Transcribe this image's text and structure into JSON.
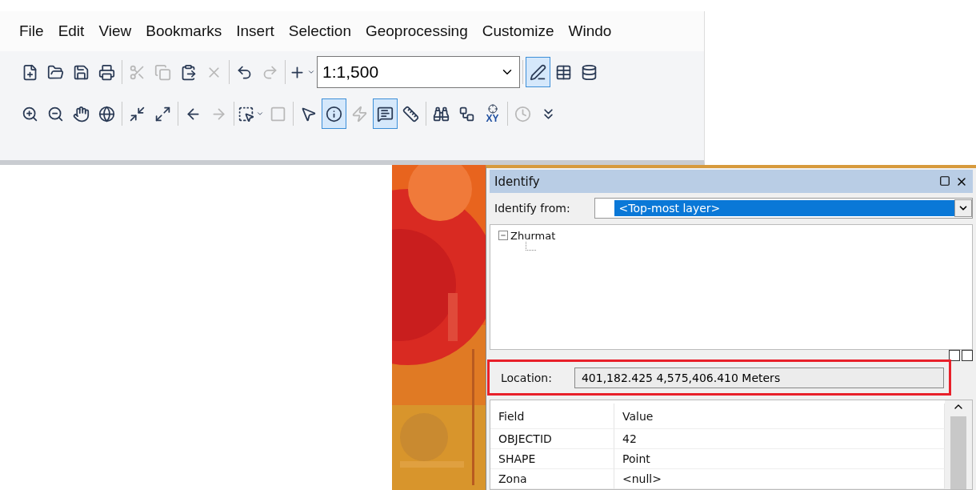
{
  "menu": [
    {
      "label": "File"
    },
    {
      "label": "Edit"
    },
    {
      "label": "View"
    },
    {
      "label": "Bookmarks"
    },
    {
      "label": "Insert"
    },
    {
      "label": "Selection"
    },
    {
      "label": "Geoprocessing"
    },
    {
      "label": "Customize"
    },
    {
      "label": "Windo"
    }
  ],
  "toolbar_1": [
    {
      "kind": "new",
      "selected": false,
      "disabled": false
    },
    {
      "kind": "open",
      "selected": false,
      "disabled": false
    },
    {
      "kind": "save",
      "selected": false,
      "disabled": false
    },
    {
      "kind": "print",
      "selected": false,
      "disabled": false
    },
    {
      "kind": "separator"
    },
    {
      "kind": "cut",
      "selected": false,
      "disabled": true
    },
    {
      "kind": "copy",
      "selected": false,
      "disabled": true
    },
    {
      "kind": "paste",
      "selected": false,
      "disabled": false
    },
    {
      "kind": "delete",
      "selected": false,
      "disabled": true
    },
    {
      "kind": "separator"
    },
    {
      "kind": "undo",
      "selected": false,
      "disabled": false
    },
    {
      "kind": "redo",
      "selected": false,
      "disabled": true
    },
    {
      "kind": "separator"
    },
    {
      "kind": "add-data",
      "selected": false,
      "disabled": false
    },
    {
      "kind": "scale",
      "value": "1:1,500"
    },
    {
      "kind": "separator"
    },
    {
      "kind": "editor",
      "selected": true,
      "disabled": false
    },
    {
      "kind": "table",
      "selected": false,
      "disabled": false
    },
    {
      "kind": "catalog",
      "selected": false,
      "disabled": false
    }
  ],
  "toolbar_2": [
    {
      "kind": "zoom-in",
      "selected": false,
      "disabled": false
    },
    {
      "kind": "zoom-out",
      "selected": false,
      "disabled": false
    },
    {
      "kind": "pan",
      "selected": false,
      "disabled": false
    },
    {
      "kind": "globe",
      "selected": false,
      "disabled": false
    },
    {
      "kind": "separator"
    },
    {
      "kind": "shrink",
      "selected": false,
      "disabled": false
    },
    {
      "kind": "expand",
      "selected": false,
      "disabled": false
    },
    {
      "kind": "separator"
    },
    {
      "kind": "back",
      "selected": false,
      "disabled": false
    },
    {
      "kind": "forward",
      "selected": false,
      "disabled": true
    },
    {
      "kind": "separator"
    },
    {
      "kind": "select",
      "selected": false,
      "disabled": false
    },
    {
      "kind": "clear",
      "selected": false,
      "disabled": true
    },
    {
      "kind": "separator"
    },
    {
      "kind": "pointer",
      "selected": false,
      "disabled": false
    },
    {
      "kind": "identify",
      "selected": true,
      "disabled": false
    },
    {
      "kind": "hyperlink",
      "selected": false,
      "disabled": true
    },
    {
      "kind": "popup",
      "selected": true,
      "disabled": false
    },
    {
      "kind": "measure",
      "selected": false,
      "disabled": false
    },
    {
      "kind": "separator"
    },
    {
      "kind": "find",
      "selected": false,
      "disabled": false
    },
    {
      "kind": "route",
      "selected": false,
      "disabled": false
    },
    {
      "kind": "goto-xy",
      "selected": false,
      "disabled": false,
      "label": "XY"
    },
    {
      "kind": "separator"
    },
    {
      "kind": "time",
      "selected": false,
      "disabled": true
    },
    {
      "kind": "overflow",
      "selected": false,
      "disabled": false
    }
  ],
  "identify": {
    "title": "Identify",
    "from_label": "Identify from:",
    "from_value": "<Top-most layer>",
    "tree": [
      {
        "label": "Zhurmat",
        "expanded": true
      }
    ],
    "location_label": "Location:",
    "location_value": "401,182.425  4,575,406.410 Meters",
    "location_highlighted": true,
    "table": {
      "columns": [
        "Field",
        "Value"
      ],
      "rows": [
        [
          "OBJECTID",
          "42"
        ],
        [
          "SHAPE",
          "Point"
        ],
        [
          "Zona",
          "<null>"
        ]
      ]
    }
  }
}
